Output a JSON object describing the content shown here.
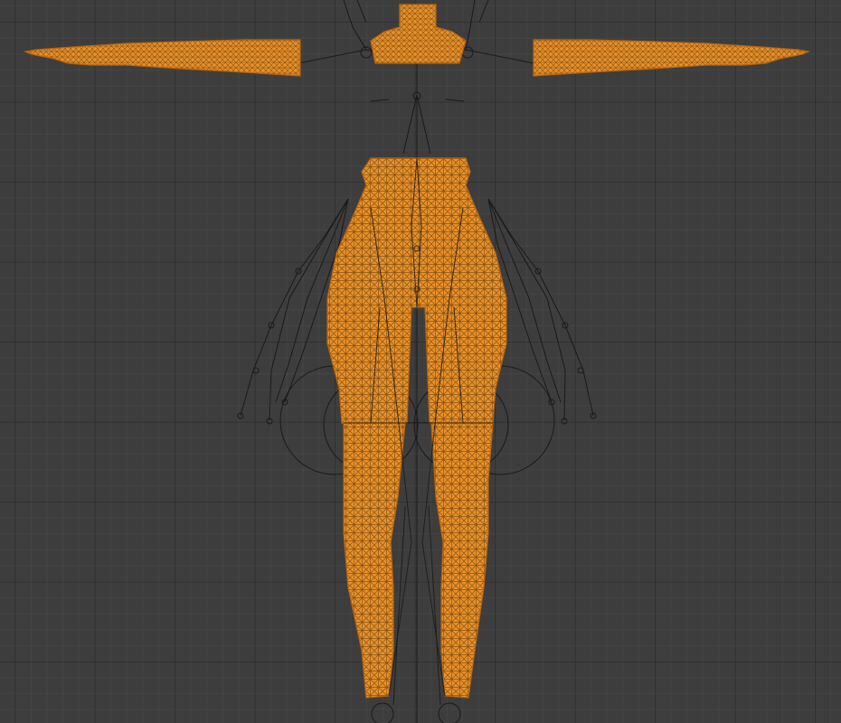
{
  "viewport": {
    "mode": "wireframe",
    "view": "front"
  },
  "colors": {
    "background": "#3d3d3d",
    "grid": "#2f2f2f",
    "mesh_fill": "#e8902a",
    "mesh_wire": "#7a4a10",
    "bones": "#1a1a1a"
  },
  "objects": [
    {
      "name": "mesh",
      "selected": true
    },
    {
      "name": "armature",
      "selected": false
    }
  ]
}
